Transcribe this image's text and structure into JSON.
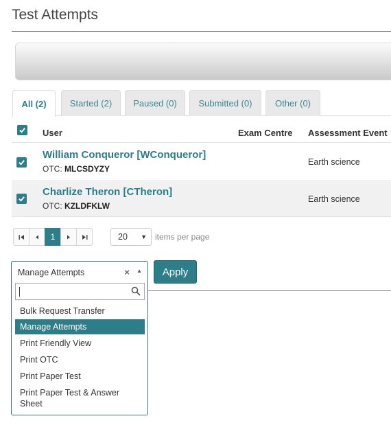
{
  "page": {
    "title": "Test Attempts"
  },
  "tabs": [
    {
      "label": "All (2)",
      "active": true
    },
    {
      "label": "Started (2)"
    },
    {
      "label": "Paused (0)"
    },
    {
      "label": "Submitted (0)"
    },
    {
      "label": "Other (0)"
    }
  ],
  "table": {
    "columns": [
      "User",
      "Exam Centre",
      "Assessment Event"
    ],
    "rows": [
      {
        "user": "William Conqueror [WConqueror]",
        "otc_label": "OTC:",
        "otc": "MLCSDYZY",
        "exam_centre": "",
        "event": "Earth science",
        "checked": true
      },
      {
        "user": "Charlize Theron [CTheron]",
        "otc_label": "OTC:",
        "otc": "KZLDFKLW",
        "exam_centre": "",
        "event": "Earth science",
        "checked": true
      }
    ]
  },
  "pager": {
    "first_icon": "first-page-icon",
    "prev_icon": "prev-page-icon",
    "current_page": "1",
    "next_icon": "next-page-icon",
    "last_icon": "last-page-icon",
    "per_page": "20",
    "per_page_label": "items per page"
  },
  "actions": {
    "selected": "Manage Attempts",
    "apply_label": "Apply",
    "search_value": "",
    "options": [
      "Bulk Request Transfer",
      "Manage Attempts",
      "Print Friendly View",
      "Print OTC",
      "Print Paper Test",
      "Print Paper Test & Answer Sheet"
    ]
  },
  "colors": {
    "accent": "#2d7e89"
  }
}
